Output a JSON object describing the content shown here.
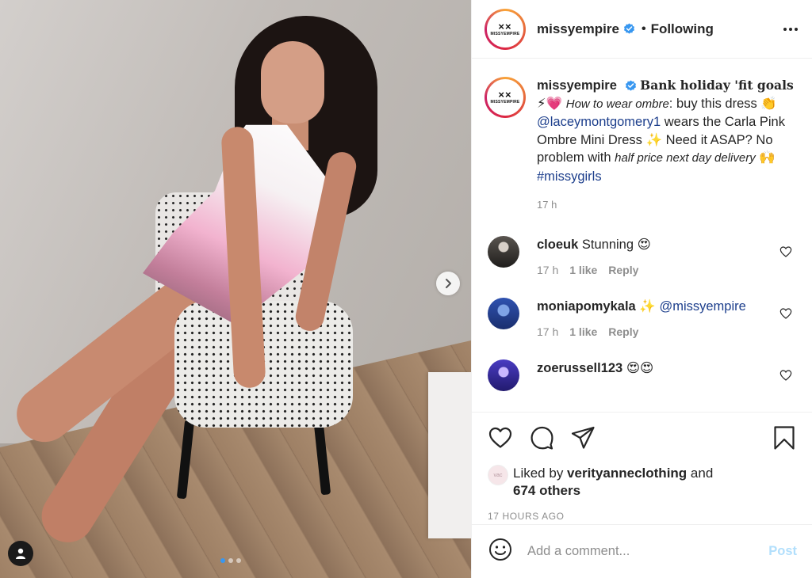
{
  "post": {
    "username": "missyempire",
    "follow_separator": "•",
    "follow_label": "Following",
    "avatar_logo_mark": "××",
    "avatar_logo_text": "MISSYEMPIRE",
    "carousel_current": 1,
    "carousel_total": 3
  },
  "caption": {
    "username": "missyempire",
    "title": "Bank holiday 'fit goals",
    "emojis_1": "⚡💗",
    "how_to": "How to wear ombre",
    "text_1": ": buy this dress",
    "emoji_2": "👏",
    "mention": "@laceymontgomery1",
    "text_2": " wears the Carla Pink Ombre Mini Dress",
    "emoji_3": "✨",
    "text_3": " Need it ASAP? No problem with ",
    "half_price": "half price next day delivery",
    "emoji_4": "🙌",
    "hashtag": "#missygirls",
    "time": "17 h"
  },
  "comments": [
    {
      "username": "cloeuk",
      "text": "Stunning 😍",
      "time": "17 h",
      "likes": "1 like",
      "reply": "Reply",
      "avatar_color": "#3a3a3a"
    },
    {
      "username": "moniapomykala",
      "text": "✨ ",
      "mention": "@missyempire",
      "time": "17 h",
      "likes": "1 like",
      "reply": "Reply",
      "avatar_color": "#2a4aa0"
    },
    {
      "username": "zoerussell123",
      "text": "😍😍",
      "avatar_color": "#3a2fa0"
    }
  ],
  "likes": {
    "prefix": "Liked by ",
    "liker": "verityanneclothing",
    "connector": " and",
    "others": "674 others",
    "mini_avatar_text": "vac"
  },
  "date": "17 HOURS AGO",
  "add_comment": {
    "placeholder": "Add a comment...",
    "post_label": "Post"
  },
  "colors": {
    "link": "#1c3e8c",
    "verified": "#3897f0",
    "post_disabled": "#b2dffc",
    "muted": "#8e8e8e"
  },
  "icons": [
    "chevron-right-icon",
    "user-tag-icon",
    "verified-icon",
    "more-icon",
    "heart-icon",
    "comment-icon",
    "share-icon",
    "bookmark-icon",
    "emoji-icon"
  ]
}
